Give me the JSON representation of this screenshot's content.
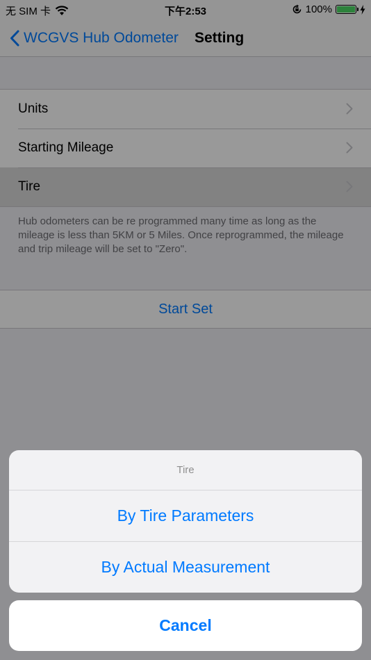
{
  "status_bar": {
    "carrier": "无 SIM 卡",
    "time": "下午2:53",
    "battery_percent": "100%",
    "battery_level": 1.0,
    "battery_color": "#4cd964"
  },
  "nav": {
    "back_label": "WCGVS Hub Odometer",
    "title": "Setting"
  },
  "settings": {
    "rows": [
      {
        "label": "Units"
      },
      {
        "label": "Starting Mileage"
      },
      {
        "label": "Tire"
      }
    ],
    "footer": "Hub odometers can be re programmed many time as long as the mileage is less than 5KM or 5 Miles. Once reprogrammed, the mileage and trip mileage will be set to \"Zero\".",
    "start_set": "Start Set"
  },
  "action_sheet": {
    "title": "Tire",
    "options": [
      {
        "label": "By Tire Parameters"
      },
      {
        "label": "By Actual Measurement"
      }
    ],
    "cancel": "Cancel"
  },
  "colors": {
    "accent": "#007aff",
    "background": "#efeff4"
  },
  "icons": {
    "signal": "wifi-icon",
    "orientation_lock": "orientation-lock-icon",
    "charging": "charging-bolt-icon",
    "back": "chevron-left-icon",
    "disclosure": "chevron-right-icon"
  }
}
